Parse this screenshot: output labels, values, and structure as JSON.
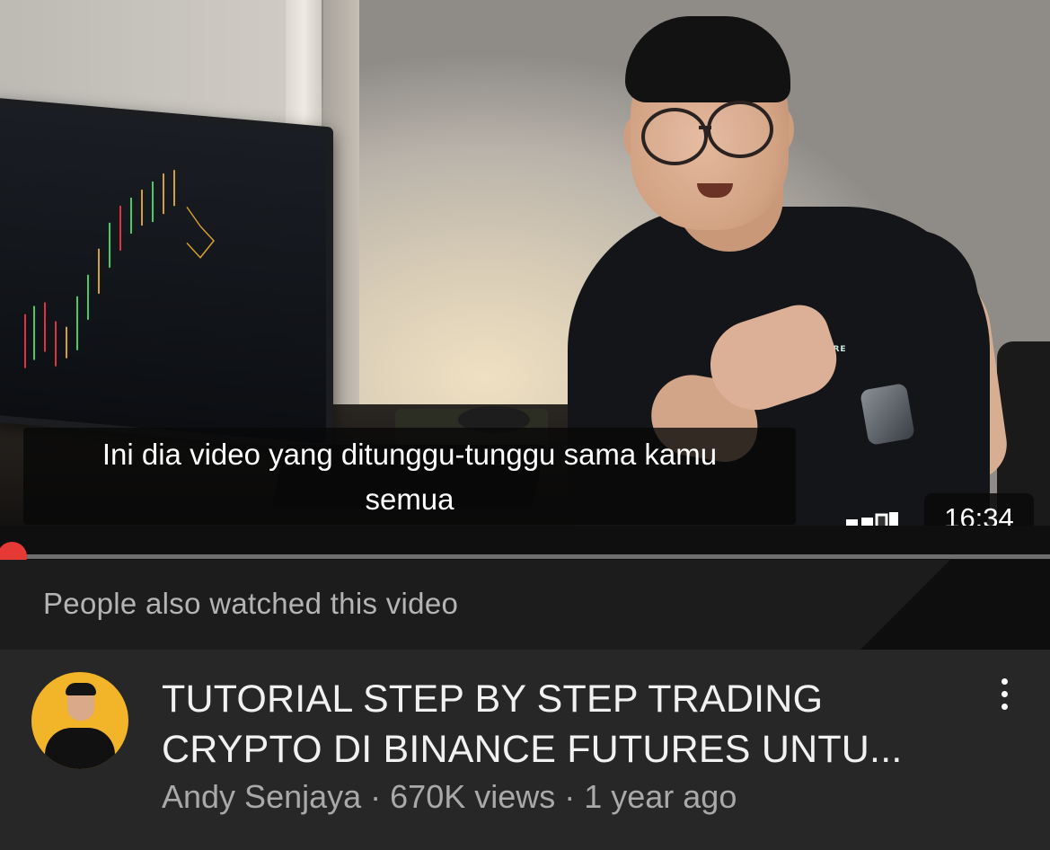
{
  "player": {
    "caption_line1": "Ini dia video yang ditunggu-tunggu sama kamu",
    "caption_line2": "semua",
    "duration": "16:34",
    "progress_fraction": 0.0,
    "shirt_logo": "TURE",
    "accent_color": "#e53935"
  },
  "banner": {
    "text": "People also watched this video"
  },
  "recommendation": {
    "title_line1": "TUTORIAL STEP BY STEP TRADING",
    "title_line2": "CRYPTO DI BINANCE FUTURES UNTU...",
    "channel": "Andy Senjaya",
    "views": "670K views",
    "age": "1 year ago",
    "meta": "Andy Senjaya · 670K views · 1 year ago",
    "avatar_bg": "#f2b428"
  },
  "icons": {
    "signal": "signal-strength-icon",
    "more": "more-vert-icon"
  }
}
